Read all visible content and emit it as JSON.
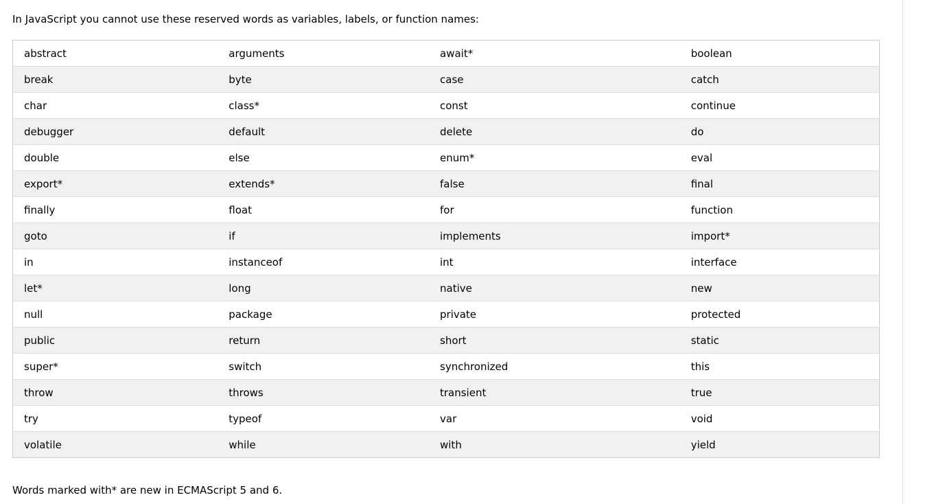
{
  "intro": "In JavaScript you cannot use these reserved words as variables, labels, or function names:",
  "table": {
    "rows": [
      [
        "abstract",
        "arguments",
        "await*",
        "boolean"
      ],
      [
        "break",
        "byte",
        "case",
        "catch"
      ],
      [
        "char",
        "class*",
        "const",
        "continue"
      ],
      [
        "debugger",
        "default",
        "delete",
        "do"
      ],
      [
        "double",
        "else",
        "enum*",
        "eval"
      ],
      [
        "export*",
        "extends*",
        "false",
        "final"
      ],
      [
        "finally",
        "float",
        "for",
        "function"
      ],
      [
        "goto",
        "if",
        "implements",
        "import*"
      ],
      [
        "in",
        "instanceof",
        "int",
        "interface"
      ],
      [
        "let*",
        "long",
        "native",
        "new"
      ],
      [
        "null",
        "package",
        "private",
        "protected"
      ],
      [
        "public",
        "return",
        "short",
        "static"
      ],
      [
        "super*",
        "switch",
        "synchronized",
        "this"
      ],
      [
        "throw",
        "throws",
        "transient",
        "true"
      ],
      [
        "try",
        "typeof",
        "var",
        "void"
      ],
      [
        "volatile",
        "while",
        "with",
        "yield"
      ]
    ]
  },
  "note": "Words marked with* are new in ECMAScript 5 and 6.",
  "colors": {
    "stripe": "#f1f1f1",
    "border": "#cccccc",
    "row_border": "#dddddd"
  }
}
